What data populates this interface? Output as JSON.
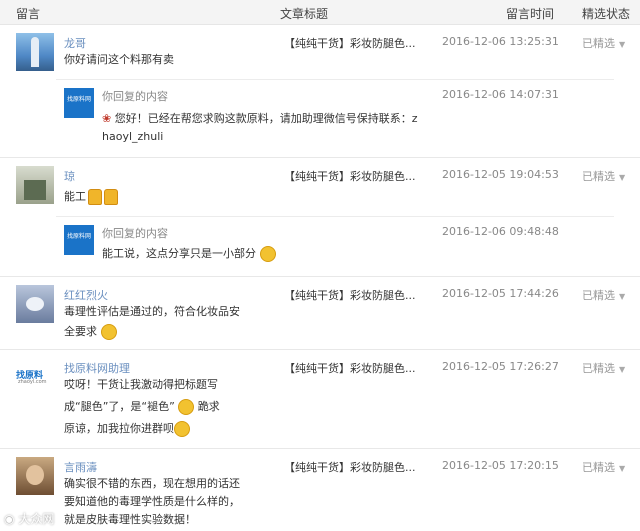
{
  "header": {
    "col_comment": "留言",
    "col_title": "文章标题",
    "col_time": "留言时间",
    "col_status": "精选状态"
  },
  "rows": [
    {
      "name": "龙哥",
      "text": "你好请问这个料那有卖",
      "title": "【纯纯干货】彩妆防腿色...",
      "time": "2016-12-06 13:25:31",
      "status": "已精选",
      "reply": {
        "label": "你回复的内容",
        "text1": "您好！已经在帮您求购这款原料，请加助理微信号保持联系：z",
        "text2": "haoyl_zhuli",
        "time": "2016-12-06 14:07:31"
      }
    },
    {
      "name": "琼",
      "text": "能工",
      "title": "【纯纯干货】彩妆防腿色...",
      "time": "2016-12-05 19:04:53",
      "status": "已精选",
      "reply": {
        "label": "你回复的内容",
        "text1": "能工说，这点分享只是一小部分",
        "time": "2016-12-06 09:48:48"
      }
    },
    {
      "name": "红红烈火",
      "text1": "毒理性评估是通过的，符合化妆品安",
      "text2": "全要求",
      "title": "【纯纯干货】彩妆防腿色...",
      "time": "2016-12-05 17:44:26",
      "status": "已精选"
    },
    {
      "name": "找原料网助理",
      "text1": "哎呀！干货让我激动得把标题写",
      "text2": "成“腿色”了，是“褪色”",
      "text2b": "跪求",
      "text3": "原谅，加我拉你进群呗",
      "title": "【纯纯干货】彩妆防腿色...",
      "time": "2016-12-05 17:26:27",
      "status": "已精选"
    },
    {
      "name": "言雨濤",
      "text1": "确实很不错的东西，现在想用的话还",
      "text2": "要知道他的毒理学性质是什么样的，",
      "text3": "就是皮肤毒理性实验数据！",
      "title": "【纯纯干货】彩妆防腿色...",
      "time": "2016-12-05 17:20:15",
      "status": "已精选"
    }
  ],
  "logo": {
    "text": "找原料网",
    "sub": "找原料",
    "site": "zhaoyl.com"
  },
  "watermark": "大众网"
}
